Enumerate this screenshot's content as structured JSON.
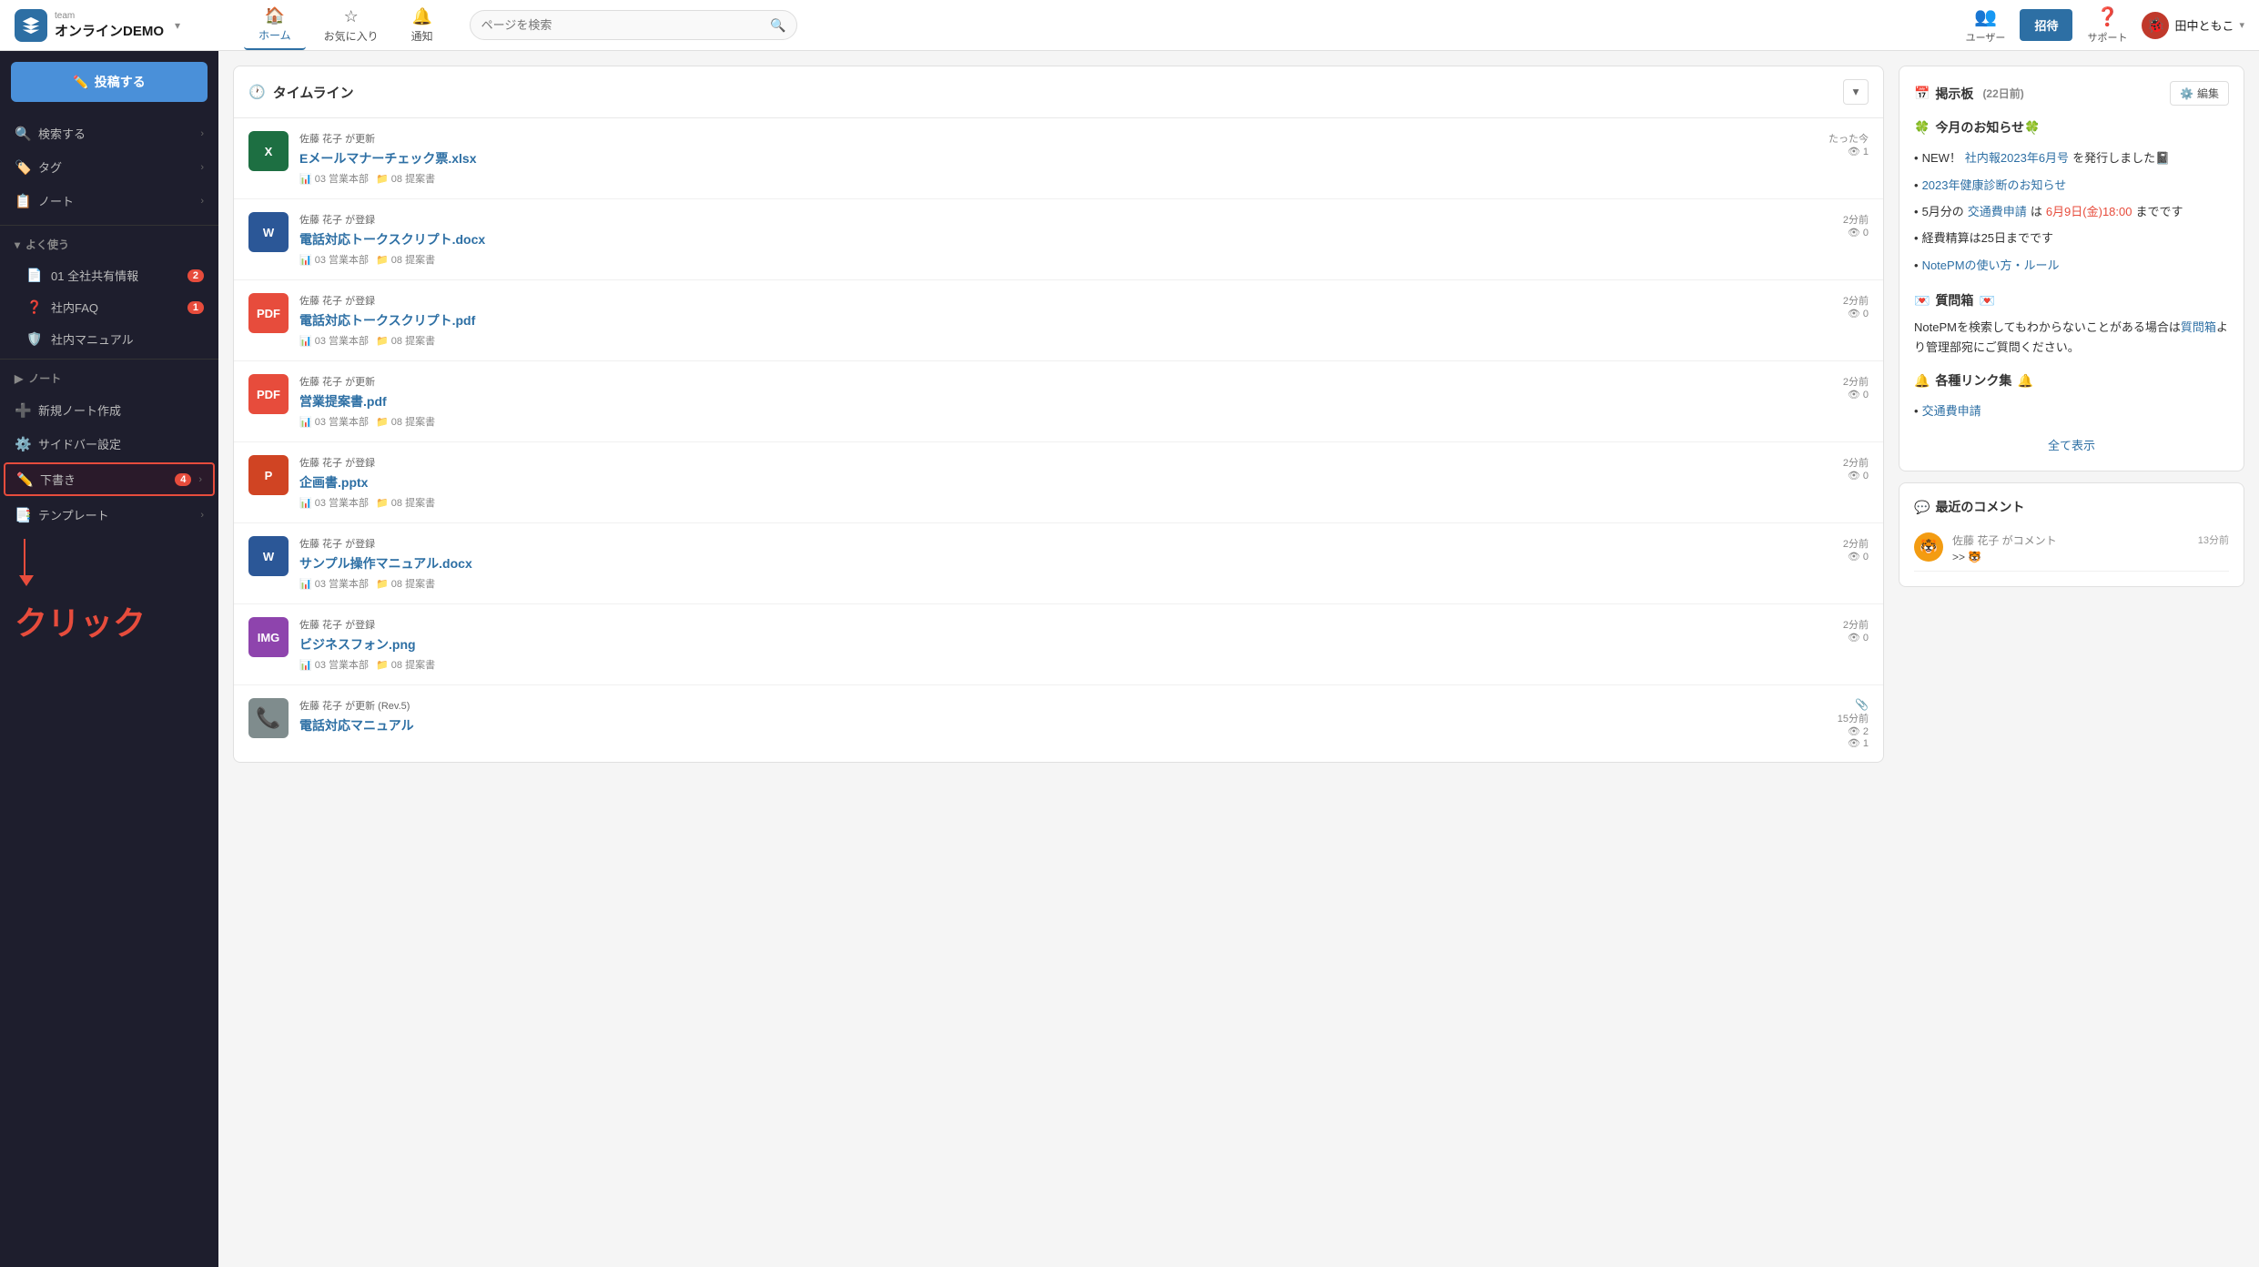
{
  "app": {
    "logo_team": "team",
    "logo_name": "オンラインDEMO"
  },
  "nav": {
    "home_label": "ホーム",
    "favorites_label": "お気に入り",
    "notifications_label": "通知",
    "search_placeholder": "ページを検索",
    "users_label": "ユーザー",
    "invite_label": "招待",
    "support_label": "サポート",
    "user_name": "田中ともこ"
  },
  "sidebar": {
    "post_btn": "投稿する",
    "search_label": "検索する",
    "tags_label": "タグ",
    "notes_label": "ノート",
    "yoku_tsukau_label": "よく使う",
    "note1_label": "01 全社共有情報",
    "note1_badge": "2",
    "note2_label": "社内FAQ",
    "note2_badge": "1",
    "note3_label": "社内マニュアル",
    "notes_section_label": "ノート",
    "new_note_label": "新規ノート作成",
    "sidebar_settings_label": "サイドバー設定",
    "drafts_label": "下書き",
    "drafts_badge": "4",
    "templates_label": "テンプレート",
    "click_label": "クリック"
  },
  "timeline": {
    "title": "タイムライン",
    "items": [
      {
        "user": "佐藤 花子 が更新",
        "time": "たった今",
        "views": "1",
        "file_name": "Eメールマナーチェック票.xlsx",
        "file_type": "xlsx",
        "dept": "03 営業本部",
        "folder": "08 提案書"
      },
      {
        "user": "佐藤 花子 が登録",
        "time": "2分前",
        "views": "0",
        "file_name": "電話対応トークスクリプト.docx",
        "file_type": "docx",
        "dept": "03 営業本部",
        "folder": "08 提案書"
      },
      {
        "user": "佐藤 花子 が登録",
        "time": "2分前",
        "views": "0",
        "file_name": "電話対応トークスクリプト.pdf",
        "file_type": "pdf",
        "dept": "03 営業本部",
        "folder": "08 提案書"
      },
      {
        "user": "佐藤 花子 が更新",
        "time": "2分前",
        "views": "0",
        "file_name": "営業提案書.pdf",
        "file_type": "pdf",
        "dept": "03 営業本部",
        "folder": "08 提案書"
      },
      {
        "user": "佐藤 花子 が登録",
        "time": "2分前",
        "views": "0",
        "file_name": "企画書.pptx",
        "file_type": "pptx",
        "dept": "03 営業本部",
        "folder": "08 提案書"
      },
      {
        "user": "佐藤 花子 が登録",
        "time": "2分前",
        "views": "0",
        "file_name": "サンプル操作マニュアル.docx",
        "file_type": "docx",
        "dept": "03 営業本部",
        "folder": "08 提案書"
      },
      {
        "user": "佐藤 花子 が登録",
        "time": "2分前",
        "views": "0",
        "file_name": "ビジネスフォン.png",
        "file_type": "png",
        "dept": "03 営業本部",
        "folder": "08 提案書"
      },
      {
        "user": "佐藤 花子 が更新 (Rev.5)",
        "time": "15分前",
        "views": "2",
        "views2": "1",
        "file_name": "電話対応マニュアル",
        "file_type": "phone",
        "dept": "",
        "folder": ""
      }
    ]
  },
  "bulletin": {
    "title": "掲示板",
    "days_ago": "(22日前)",
    "edit_label": "編集",
    "news_section": "今月のお知らせ🍀",
    "news_items": [
      {
        "text": "NEW！社内報2023年6月号を発行しました📓",
        "has_link": true,
        "link_text": "社内報2023年6月号"
      },
      {
        "text": "2023年健康診断のお知らせ",
        "has_link": true,
        "link_text": "2023年健康診断のお知らせ"
      },
      {
        "text": "5月分の交通費申請は6月9日(金)18:00までです",
        "has_link": true,
        "link_text": "交通費申請",
        "after": "は",
        "date": "6月9日(金)18:00",
        "suffix": "までです"
      },
      {
        "text": "経費精算は25日までです",
        "has_link": false
      },
      {
        "text": "NotePMの使い方・ルール",
        "has_link": true,
        "link_text": "NotePMの使い方・ルール"
      }
    ],
    "qa_section": "質問箱",
    "qa_text": "NotePMを検索してもわからないことがある場合は",
    "qa_link_text": "質問箱",
    "qa_text2": "より管理部宛にご質問ください。",
    "links_section": "各種リンク集",
    "link_items": [
      {
        "text": "交通費申請",
        "is_link": true
      }
    ],
    "show_all": "全て表示"
  },
  "recent_comments": {
    "title": "最近のコメント",
    "items": [
      {
        "user": "佐藤 花子 がコメント",
        "time": "13分前",
        "preview": ">> 🐯"
      }
    ]
  }
}
